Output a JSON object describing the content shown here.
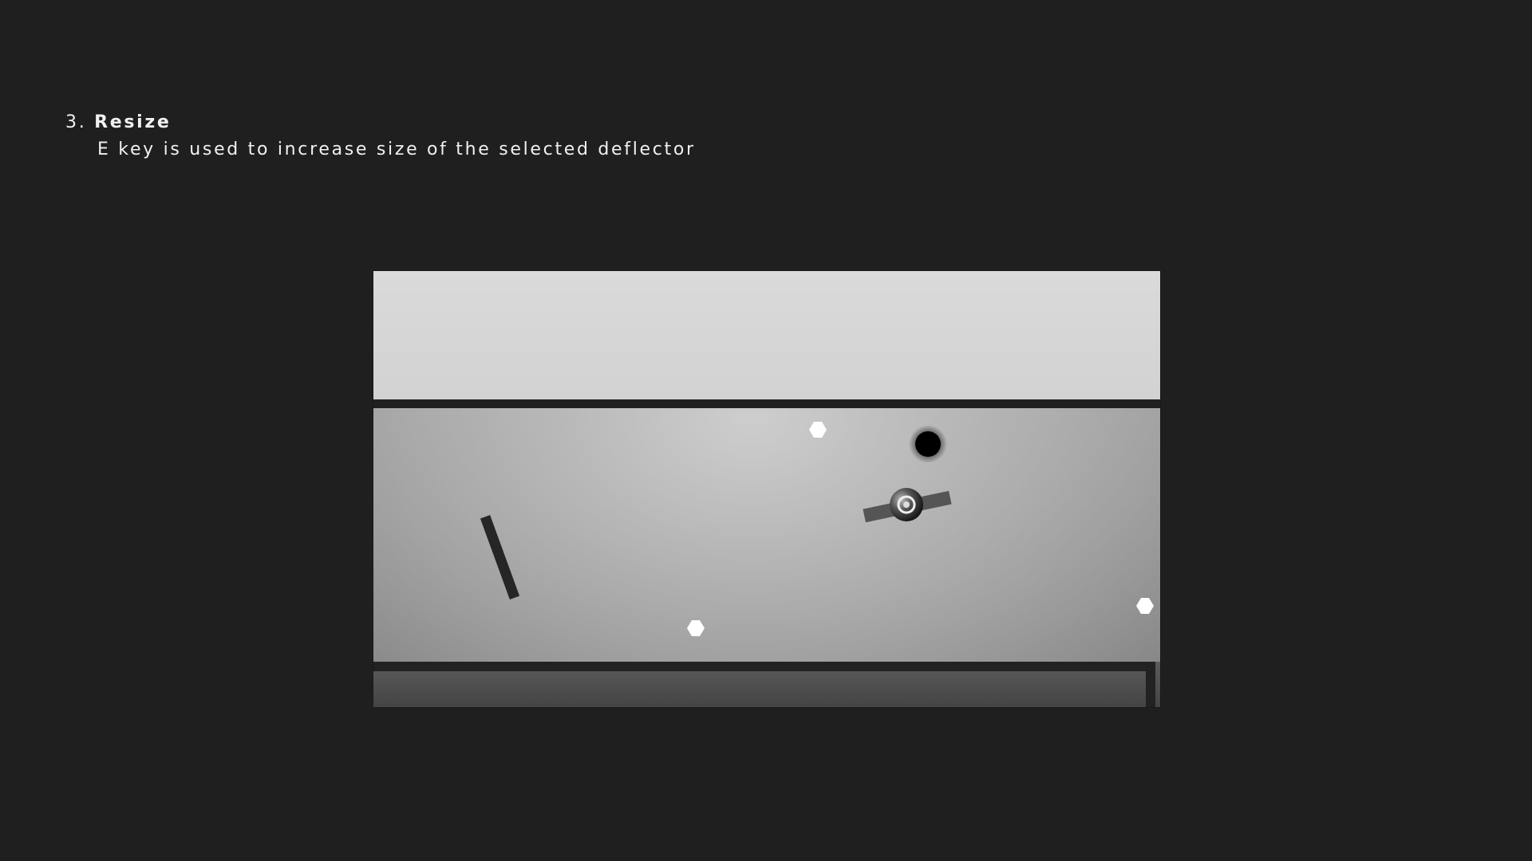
{
  "tutorial": {
    "step_number": "3.",
    "step_title": "Resize",
    "description": "E key is used to increase size of the selected deflector"
  },
  "game_scene": {
    "colors": {
      "background": "#1f1f1f",
      "text": "#f1f1f1",
      "wall": "#222222",
      "deflector": "#262626",
      "selected_deflector": "#555555",
      "collectible": "#ffffff",
      "ball": "#000000"
    },
    "objects": {
      "ball": "black-ball",
      "selected_deflector": "selected-deflector",
      "deflector": "deflector",
      "collectibles": [
        "hexagon-collectible",
        "hexagon-collectible",
        "hexagon-collectible"
      ]
    }
  }
}
